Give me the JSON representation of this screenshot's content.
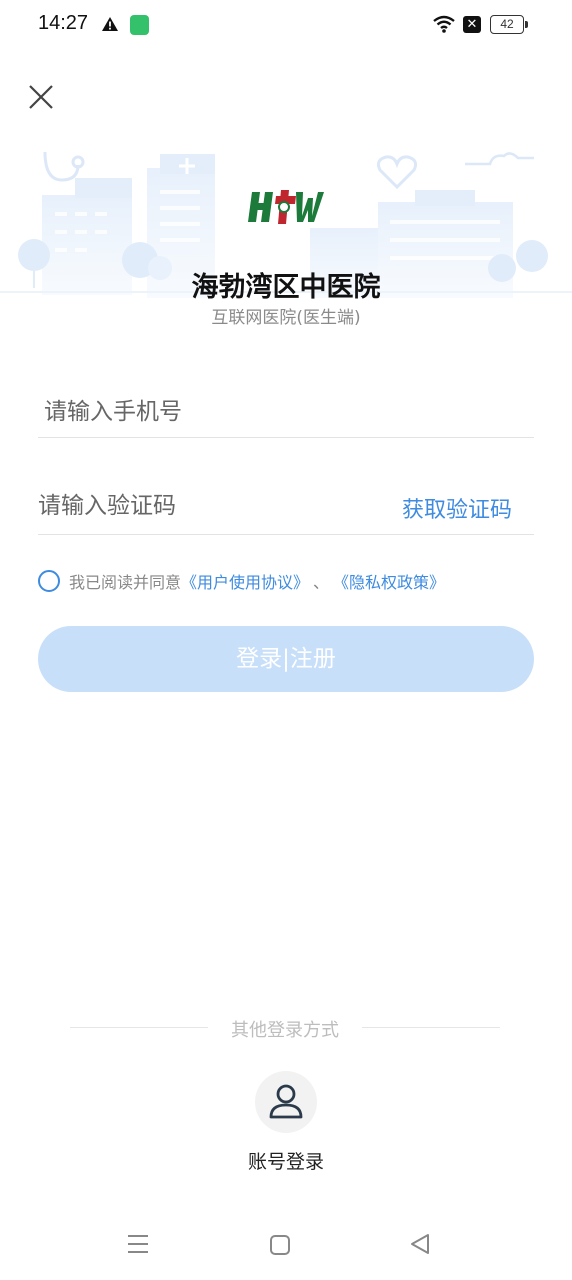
{
  "status_bar": {
    "time": "14:27",
    "battery": "42",
    "icons": [
      "warning-icon",
      "app-notification-icon",
      "wifi-icon",
      "sim-off-icon",
      "battery-icon"
    ]
  },
  "header": {
    "close_icon": "close-icon"
  },
  "hospital": {
    "name": "海勃湾区中医院",
    "subtitle": "互联网医院(医生端)",
    "logo_text": "HBW"
  },
  "form": {
    "phone_placeholder": "请输入手机号",
    "code_placeholder": "请输入验证码",
    "get_code_label": "获取验证码"
  },
  "agreement": {
    "prefix": "我已阅读并同意",
    "user_agreement": "《用户使用协议》",
    "separator": "、",
    "privacy_policy": "《隐私权政策》"
  },
  "login_button": "登录|注册",
  "other_login": {
    "title": "其他登录方式",
    "account_login": "账号登录"
  },
  "colors": {
    "accent": "#3e8be0",
    "button_disabled": "#c8dffa",
    "banner_light": "#e9f2fc"
  },
  "nav_bar": {
    "icons": [
      "menu-icon",
      "home-icon",
      "back-icon"
    ]
  }
}
